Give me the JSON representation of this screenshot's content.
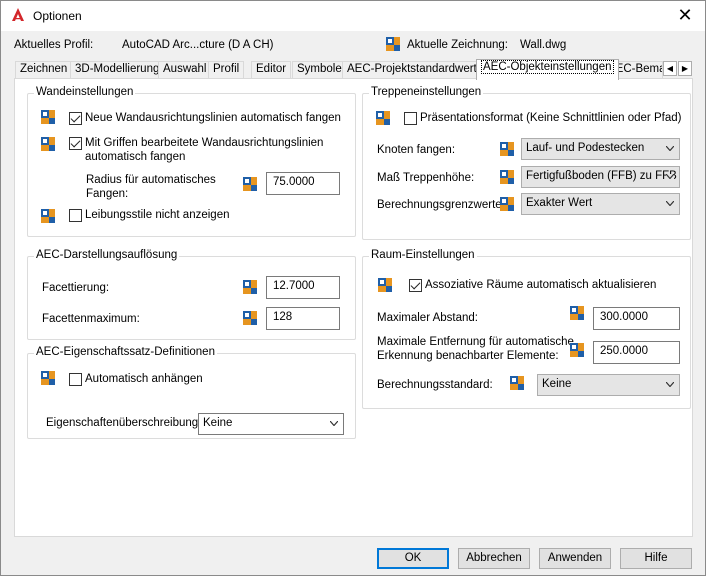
{
  "window": {
    "title": "Optionen"
  },
  "profile": {
    "label": "Aktuelles Profil:",
    "value": "AutoCAD Arc...cture (D A CH)",
    "drawing_label": "Aktuelle Zeichnung:",
    "drawing_value": "Wall.dwg"
  },
  "tabs": [
    "Zeichnen",
    "3D-Modellierung",
    "Auswahl",
    "Profil",
    "Editor",
    "Symbole",
    "AEC-Projektstandardwerte",
    "AEC-Objekteinstellungen",
    "AEC-Bema"
  ],
  "active_tab": "AEC-Objekteinstellungen",
  "wall": {
    "title": "Wandeinstellungen",
    "new_lines": {
      "checked": true,
      "label": "Neue Wandausrichtungslinien automatisch fangen"
    },
    "grip_lines": {
      "checked": true,
      "label_1": "Mit Griffen bearbeitete Wandausrichtungslinien",
      "label_2": "automatisch fangen"
    },
    "radius_label_1": "Radius für automatisches",
    "radius_label_2": "Fangen:",
    "radius_value": "75.0000",
    "reveal": {
      "checked": false,
      "label": "Leibungsstile nicht anzeigen"
    }
  },
  "display_res": {
    "title": "AEC-Darstellungsauflösung",
    "facet_label": "Facettierung:",
    "facet_value": "12.7000",
    "facet_max_label": "Facettenmaximum:",
    "facet_max_value": "128"
  },
  "propset": {
    "title": "AEC-Eigenschaftssatz-Definitionen",
    "auto_attach": {
      "checked": false,
      "label": "Automatisch anhängen"
    },
    "override_label": "Eigenschaftenüberschreibung",
    "override_value": "Keine"
  },
  "stair": {
    "title": "Treppeneinstellungen",
    "presentation": {
      "checked": false,
      "label": "Präsentationsformat (Keine Schnittlinien oder Pfad)"
    },
    "node_label": "Knoten fangen:",
    "node_value": "Lauf- und Podestecken",
    "measure_label": "Maß Treppenhöhe:",
    "measure_value": "Fertigfußboden (FFB) zu FFB",
    "limit_label": "Berechnungsgrenzwerte:",
    "limit_value": "Exakter Wert"
  },
  "space": {
    "title": "Raum-Einstellungen",
    "assoc": {
      "checked": true,
      "label": "Assoziative Räume automatisch aktualisieren"
    },
    "max_dist_label": "Maximaler Abstand:",
    "max_dist_value": "300.0000",
    "max_detect_label_1": "Maximale Entfernung für automatische",
    "max_detect_label_2": "Erkennung benachbarter Elemente:",
    "max_detect_value": "250.0000",
    "calc_label": "Berechnungsstandard:",
    "calc_value": "Keine"
  },
  "buttons": {
    "ok": "OK",
    "cancel": "Abbrechen",
    "apply": "Anwenden",
    "help": "Hilfe"
  },
  "icons": {
    "app": "autocad-a-icon",
    "drawing": "drawing-standards-icon",
    "setting": "drawing-scope-icon",
    "close": "close-icon"
  },
  "colors": {
    "app_red": "#d3262a",
    "accent": "#0078d7",
    "icon_blue": "#1f5fa8",
    "icon_orange": "#e69520"
  }
}
